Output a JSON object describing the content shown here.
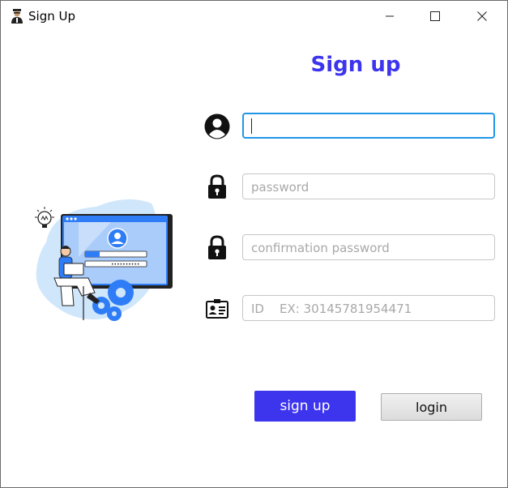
{
  "window": {
    "title": "Sign Up",
    "controls": {
      "minimize": "minimize",
      "maximize": "maximize",
      "close": "close"
    }
  },
  "form": {
    "heading": "Sign up",
    "username": {
      "value": "",
      "placeholder": ""
    },
    "password": {
      "value": "",
      "placeholder": "password"
    },
    "confirm_password": {
      "value": "",
      "placeholder": "confirmation password"
    },
    "id_field": {
      "value": "",
      "placeholder": "ID    EX: 30145781954471"
    }
  },
  "buttons": {
    "sign_up_label": "sign up",
    "login_label": "login"
  },
  "icons": {
    "app": "user-silhouette-icon",
    "username": "user-circle-icon",
    "password": "lock-icon",
    "confirm_password": "lock-icon",
    "id": "id-card-icon"
  },
  "colors": {
    "accent": "#3d34ee",
    "focus_border": "#2196e8",
    "illustration_blue": "#2f7df6",
    "illustration_light": "#cfe6fb"
  }
}
